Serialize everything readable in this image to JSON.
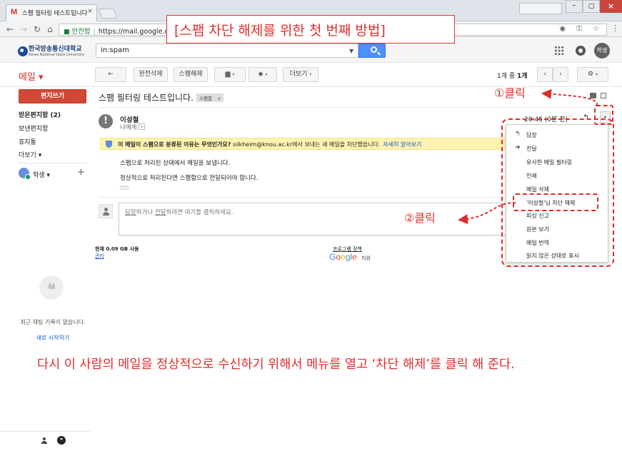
{
  "browser": {
    "tab_title": "스팸 필터링 테스트입니다",
    "tab_icon": "M",
    "tab_close": "×",
    "user_label": "",
    "secure_label": "안전함",
    "url": "https://mail.google.com",
    "omni_icons": "◉ ⚿ ☆",
    "win_min": "–",
    "win_max": "▢",
    "win_close": "×"
  },
  "header": {
    "logo_text": "한국방송통신대학교",
    "logo_sub": "Korea National Open University",
    "search_value": "in:spam",
    "avatar": "학생"
  },
  "actions": {
    "mail_label": "메일 ▾",
    "back": "←",
    "delete_forever": "완전삭제",
    "not_spam": "스팸해제",
    "move": "▆",
    "labels": "◆",
    "more": "더보기",
    "caret": "▾",
    "page_count_pre": "1개 중 ",
    "page_count_bold": "1개",
    "prev": "‹",
    "next": "›",
    "settings": "⚙"
  },
  "nav": {
    "compose": "편지쓰기",
    "inbox": "받은편지함 (2)",
    "sent": "보낸편지함",
    "trash": "휴지통",
    "more": "더보기 ▾",
    "hangout_name": "학생 ▾",
    "hangout_add": "+",
    "chat_glyph": "❝",
    "chat_empty": "최근 채팅 기록이 없습니다.",
    "chat_start": "새로 시작하기"
  },
  "message": {
    "subject": "스팸 필터링 테스트입니다.",
    "chip": "스팸함",
    "chip_x": "x",
    "warn_glyph": "!",
    "sender": "이성철",
    "to_me": "나에게",
    "to_me_caret": "▾",
    "timestamp": "20:45 (0분 전)",
    "star": "☆",
    "reply": "↰",
    "more_caret": "▾",
    "warning_bold": "이 메일이 스팸으로 분류된 이유는 무엇인가요?",
    "warning_text": " silkheim@knou.ac.kr에서 보내는 새 메일을 차단했습니다.",
    "learn_more": "자세히 알아보기",
    "body_line1": "스팸으로 처리된 상태에서 메일을 보냅니다.",
    "body_line2": "정상적으로 처리된다면 스팸함으로 전달되어야 합니다.",
    "ellipsis": "···",
    "reply_prompt_a": "답장",
    "reply_prompt_b": "하거나 ",
    "reply_prompt_c": "전달",
    "reply_prompt_d": "하려면 여기를 클릭하세요.",
    "usage": "현재 0.09 GB 사용",
    "manage": "관리",
    "program_policy": "프로그램 정책",
    "powered": "지원"
  },
  "menu": {
    "reply": "답장",
    "forward": "전달",
    "filter_similar": "유사한 메일 필터링",
    "print": "인쇄",
    "delete": "메일 삭제",
    "unblock": "'이성철'님 차단 해제",
    "phishing": "피싱 신고",
    "show_original": "원본 보기",
    "translate": "메일 번역",
    "mark_unread": "읽지 않은 상태로 표시",
    "reply_glyph": "↰",
    "forward_glyph": "➜"
  },
  "annotations": {
    "title": "[스팸 차단 해제를 위한 첫 번째 방법]",
    "step1": "①클릭",
    "step2": "②클릭",
    "caption": "다시 이 사람의 메일을 정상적으로 수신하기 위해서 메뉴를 열고 ‘차단 해제’를 클릭  해 준다."
  },
  "colors": {
    "annotation_red": "#e12b2b",
    "compose_red": "#d14836",
    "search_blue": "#4d90fe",
    "warning_yellow": "#fff3b0"
  }
}
